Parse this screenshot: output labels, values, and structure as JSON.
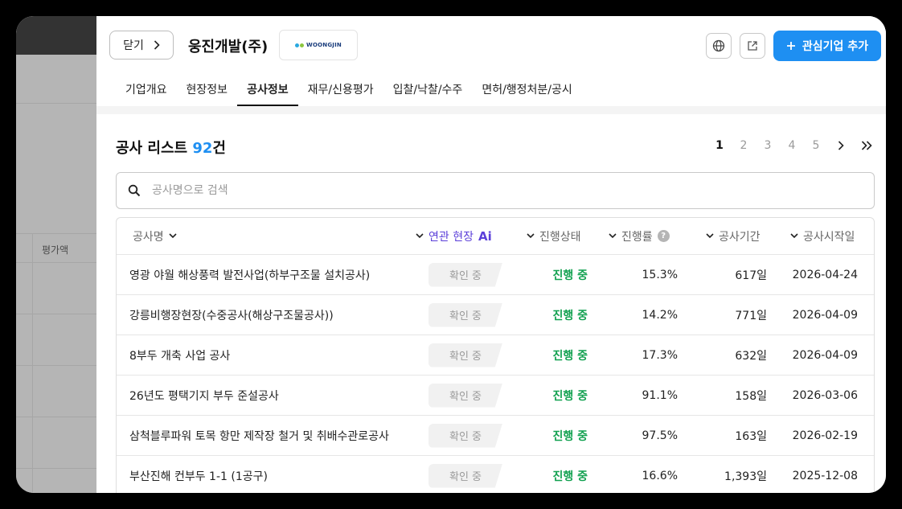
{
  "background": {
    "column_label": "평가액"
  },
  "header": {
    "close_label": "닫기",
    "company_name": "웅진개발(주)",
    "logo_text": "WOONGJIN",
    "add_button_label": "관심기업 추가"
  },
  "tabs": [
    {
      "label": "기업개요"
    },
    {
      "label": "현장정보"
    },
    {
      "label": "공사정보",
      "active": true
    },
    {
      "label": "재무/신용평가"
    },
    {
      "label": "입찰/낙찰/수주"
    },
    {
      "label": "면허/행정처분/공시"
    }
  ],
  "list": {
    "title_prefix": "공사 리스트 ",
    "count": "92",
    "title_suffix": "건",
    "pages": [
      "1",
      "2",
      "3",
      "4",
      "5"
    ],
    "active_page": "1"
  },
  "search": {
    "placeholder": "공사명으로 검색",
    "value": ""
  },
  "table": {
    "columns": {
      "name": "공사명",
      "site": "연관 현장",
      "site_ai": "Ai",
      "status": "진행상태",
      "progress": "진행률",
      "period": "공사기간",
      "start": "공사시작일"
    },
    "rows": [
      {
        "name": "영광 야월 해상풍력 발전사업(하부구조물 설치공사)",
        "site": "확인 중",
        "status": "진행 중",
        "progress": "15.3%",
        "period": "617일",
        "start": "2026-04-24"
      },
      {
        "name": "강릉비행장현장(수중공사(해상구조물공사))",
        "site": "확인 중",
        "status": "진행 중",
        "progress": "14.2%",
        "period": "771일",
        "start": "2026-04-09"
      },
      {
        "name": "8부두 개축 사업 공사",
        "site": "확인 중",
        "status": "진행 중",
        "progress": "17.3%",
        "period": "632일",
        "start": "2026-04-09"
      },
      {
        "name": "26년도 평택기지 부두 준설공사",
        "site": "확인 중",
        "status": "진행 중",
        "progress": "91.1%",
        "period": "158일",
        "start": "2026-03-06"
      },
      {
        "name": "삼척블루파워 토목 항만 제작장 철거 및 취배수관로공사",
        "site": "확인 중",
        "status": "진행 중",
        "progress": "97.5%",
        "period": "163일",
        "start": "2026-02-19"
      },
      {
        "name": "부산진해 컨부두 1-1 (1공구)",
        "site": "확인 중",
        "status": "진행 중",
        "progress": "16.6%",
        "period": "1,393일",
        "start": "2025-12-08"
      }
    ]
  },
  "colors": {
    "accent": "#1e8ff2",
    "status": "#12a150",
    "ai": "#5b3fd9"
  },
  "icons": [
    "chevron-right-icon",
    "globe-icon",
    "external-link-icon",
    "plus-icon",
    "search-icon",
    "chevron-down-icon",
    "help-icon",
    "double-chevron-right-icon"
  ]
}
